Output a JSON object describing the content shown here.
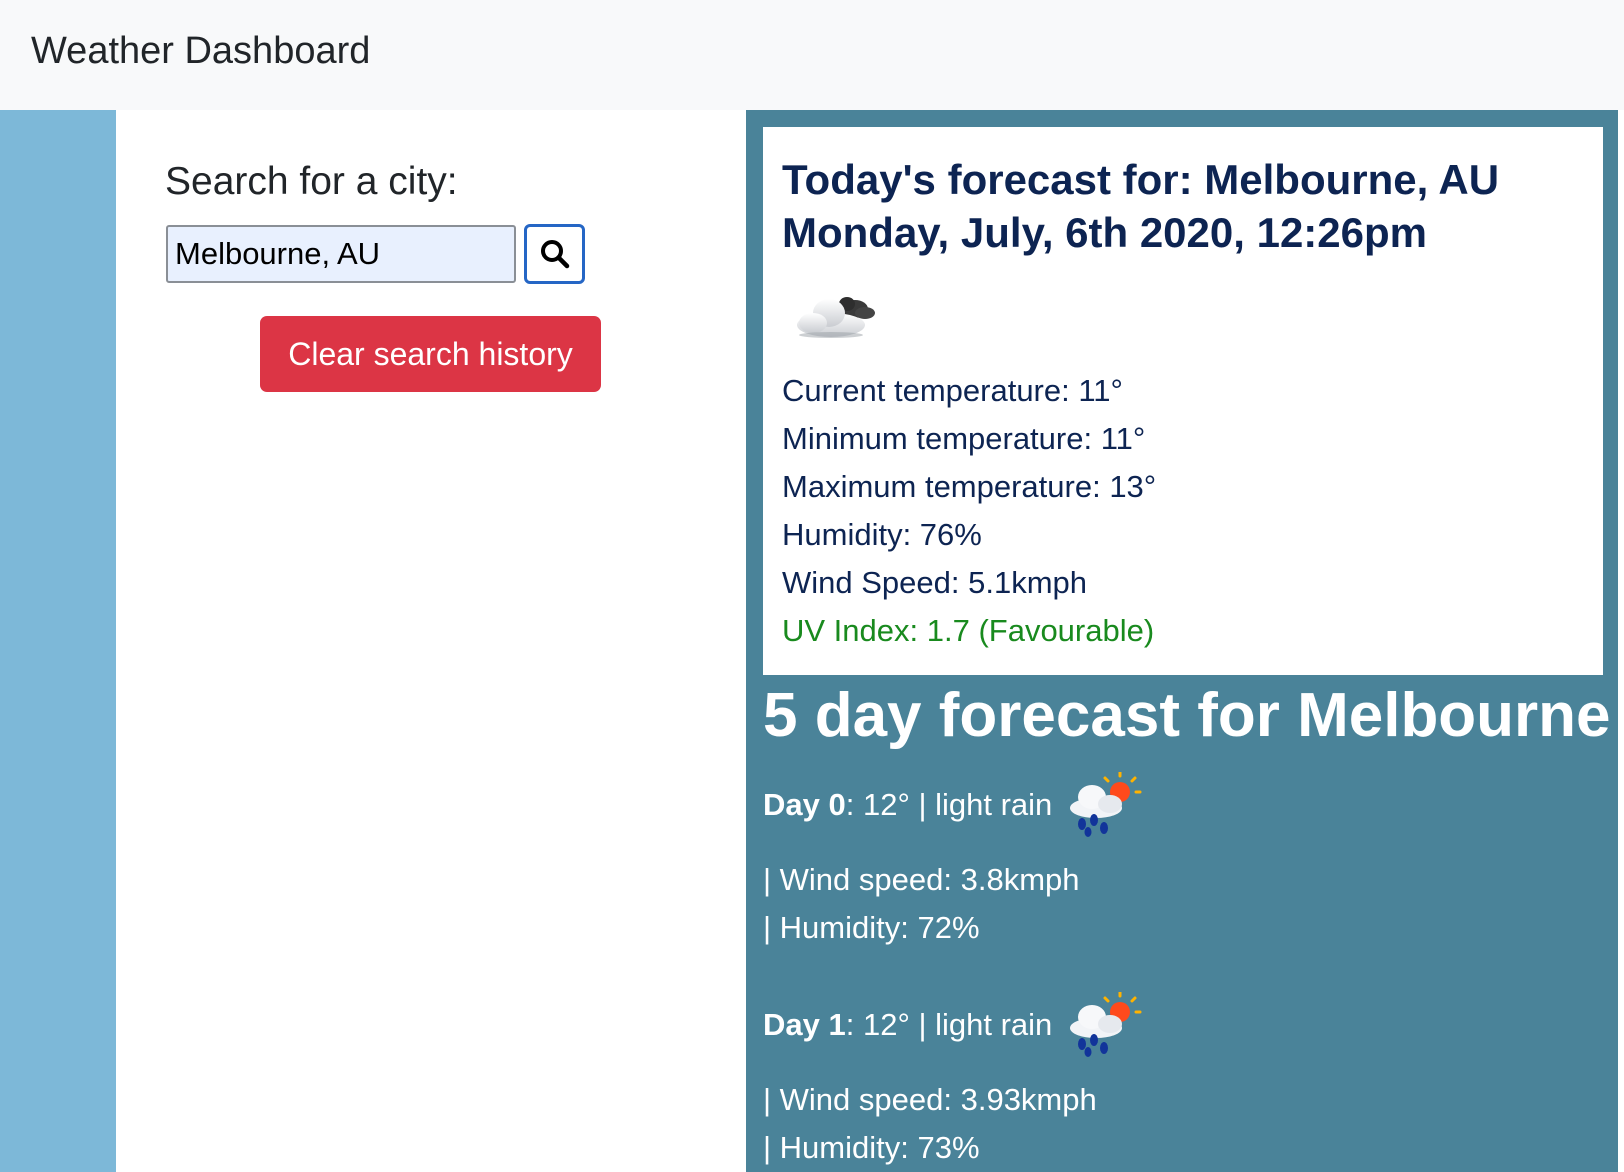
{
  "app": {
    "title": "Weather Dashboard"
  },
  "search": {
    "label": "Search for a city:",
    "value": "Melbourne, AU",
    "clear_label": "Clear search history"
  },
  "today": {
    "title_line1": "Today's forecast for: Melbourne, AU",
    "title_line2": "Monday, July, 6th 2020, 12:26pm",
    "icon": "cloudy-icon",
    "stats": [
      "Current temperature: 11°",
      "Minimum temperature: 11°",
      "Maximum temperature: 13°",
      "Humidity: 76%",
      "Wind Speed: 5.1kmph"
    ],
    "uv": "UV Index: 1.7 (Favourable)",
    "uv_color": "#198a1e"
  },
  "five_day": {
    "title": "5 day forecast for Melbourne",
    "days": [
      {
        "label": "Day 0",
        "summary": ": 12° | light rain",
        "icon": "light-rain-icon",
        "wind": "| Wind speed: 3.8kmph",
        "humidity": "| Humidity: 72%"
      },
      {
        "label": "Day 1",
        "summary": ": 12° | light rain",
        "icon": "light-rain-icon",
        "wind": "| Wind speed: 3.93kmph",
        "humidity": "| Humidity: 73%"
      }
    ]
  },
  "colors": {
    "navbar": "#f8f9fa",
    "left_strip": "#7db8d8",
    "forecast_panel": "#4a8399",
    "clear_button": "#dc3545",
    "title_text": "#0d2452"
  }
}
